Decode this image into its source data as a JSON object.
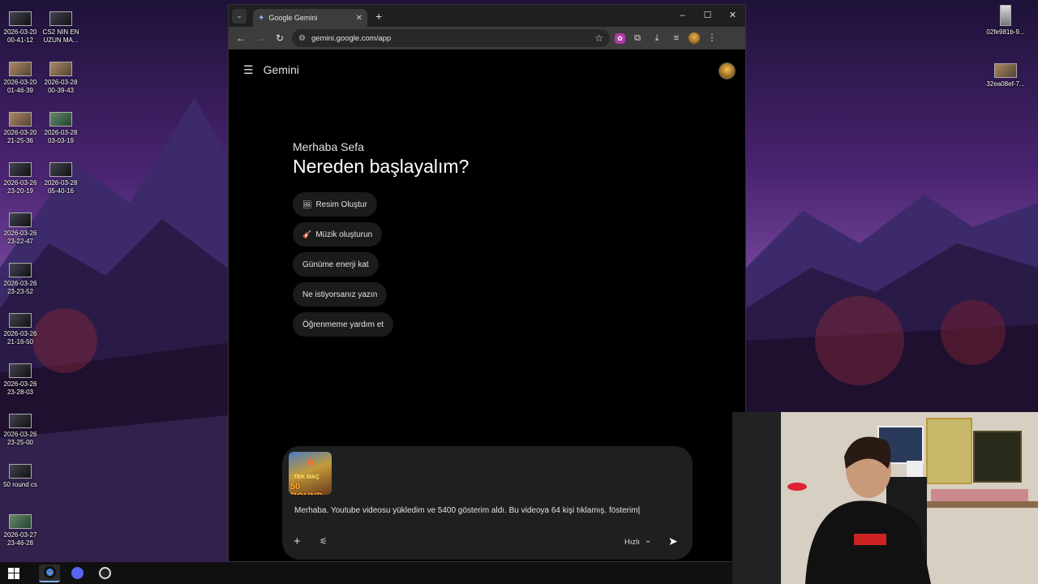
{
  "desktop": {
    "icons_left": [
      {
        "label": "2026-03-20 00-41-12",
        "style": "dark"
      },
      {
        "label": "CS2 NIN EN UZUN MA...",
        "style": "dark"
      },
      {
        "label": "2026-03-20 01-46-39",
        "style": "warm"
      },
      {
        "label": "2026-03-28 00-39-43",
        "style": "warm"
      },
      {
        "label": "2026-03-20 21-25-36",
        "style": "warm"
      },
      {
        "label": "2026-03-28 03-03-19",
        "style": "green"
      },
      {
        "label": "2026-03-26 23-20-19",
        "style": "dark"
      },
      {
        "label": "2026-03-28 05-40-16",
        "style": "dark"
      },
      {
        "label": "2026-03-26 23-22-47",
        "style": "dark"
      },
      {
        "label": "2026-03-26 23-23-52",
        "style": "dark"
      },
      {
        "label": "2026-03-26 21-16-50",
        "style": "dark"
      },
      {
        "label": "2026-03-26 23-28-03",
        "style": "dark"
      },
      {
        "label": "2026-03-26 23-25-00",
        "style": "dark"
      },
      {
        "label": "50 round cs",
        "style": "dark"
      },
      {
        "label": "2026-03-27 23-46-28",
        "style": "green"
      }
    ],
    "icons_right": [
      {
        "label": "02fe981b-9...",
        "style": "tall"
      },
      {
        "label": "32ea08ef-7...",
        "style": "warm"
      }
    ]
  },
  "browser": {
    "tab_title": "Google Gemini",
    "url": "gemini.google.com/app",
    "window_controls": [
      "–",
      "☐",
      "✕"
    ]
  },
  "gemini": {
    "brand": "Gemini",
    "greeting_small": "Merhaba Sefa",
    "greeting_big": "Nereden başlayalım?",
    "chips": [
      {
        "icon": "🖼",
        "label": "Resim Oluştur"
      },
      {
        "icon": "🎸",
        "label": "Müzik oluşturun"
      },
      {
        "icon": "",
        "label": "Günüme enerji kat"
      },
      {
        "icon": "",
        "label": "Ne istiyorsanız yazın"
      },
      {
        "icon": "",
        "label": "Öğrenmeme yardım et"
      }
    ],
    "attachment": {
      "line1": "TEK MAÇ",
      "line2": "50 ROUND",
      "line3": "A"
    },
    "prompt": "Merhaba. Youtube videosu yükledim ve 5400 gösterim aldı. Bu videoya 64 kişi tıklamış. fösterim",
    "mode_label": "Hızlı"
  }
}
